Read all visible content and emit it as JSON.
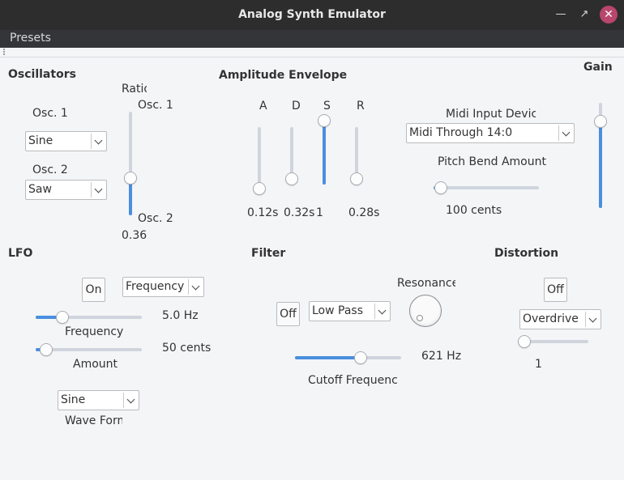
{
  "window": {
    "title": "Analog Synth Emulator"
  },
  "menubar": {
    "presets": "Presets"
  },
  "oscillators": {
    "heading": "Oscillators",
    "osc1_label": "Osc. 1",
    "osc1_wave": "Sine",
    "osc2_label": "Osc. 2",
    "osc2_wave": "Saw",
    "ratio_label": "Ratio",
    "ratio_top": "Osc. 1",
    "ratio_bottom": "Osc. 2",
    "ratio_value": "0.36",
    "ratio_level": 0.36
  },
  "envelope": {
    "heading": "Amplitude Envelope",
    "a_label": "A",
    "d_label": "D",
    "s_label": "S",
    "r_label": "R",
    "a_value": "0.12s",
    "d_value": "0.32s",
    "s_value": "1",
    "r_value": "0.28s",
    "a_level": 0.0,
    "d_level": 0.1,
    "s_level": 1.0,
    "r_level": 0.1
  },
  "midi": {
    "input_label": "Midi Input Device",
    "input_value": "Midi Through 14:0",
    "pitch_bend_label": "Pitch Bend Amount",
    "pitch_bend_value": "100 cents",
    "pitch_bend_level": 0.07
  },
  "gain": {
    "heading": "Gain",
    "level": 0.82
  },
  "lfo": {
    "heading": "LFO",
    "toggle": "On",
    "target": "Frequency",
    "freq_value": "5.0 Hz",
    "freq_label": "Frequency",
    "freq_level": 0.25,
    "amount_value": "50 cents",
    "amount_label": "Amount",
    "amount_level": 0.1,
    "wave": "Sine",
    "wave_form_label": "Wave Form"
  },
  "filter": {
    "heading": "Filter",
    "toggle": "Off",
    "type": "Low Pass",
    "resonance_label": "Resonance",
    "cutoff_value": "621 Hz",
    "cutoff_label": "Cutoff Frequency",
    "cutoff_level": 0.62
  },
  "distortion": {
    "heading": "Distortion",
    "toggle": "Off",
    "type": "Overdrive",
    "value": "1",
    "level": 0.0
  },
  "colors": {
    "accent": "#4a8fde",
    "close_button": "#b8466d",
    "titlebar": "#2d2d2d"
  }
}
